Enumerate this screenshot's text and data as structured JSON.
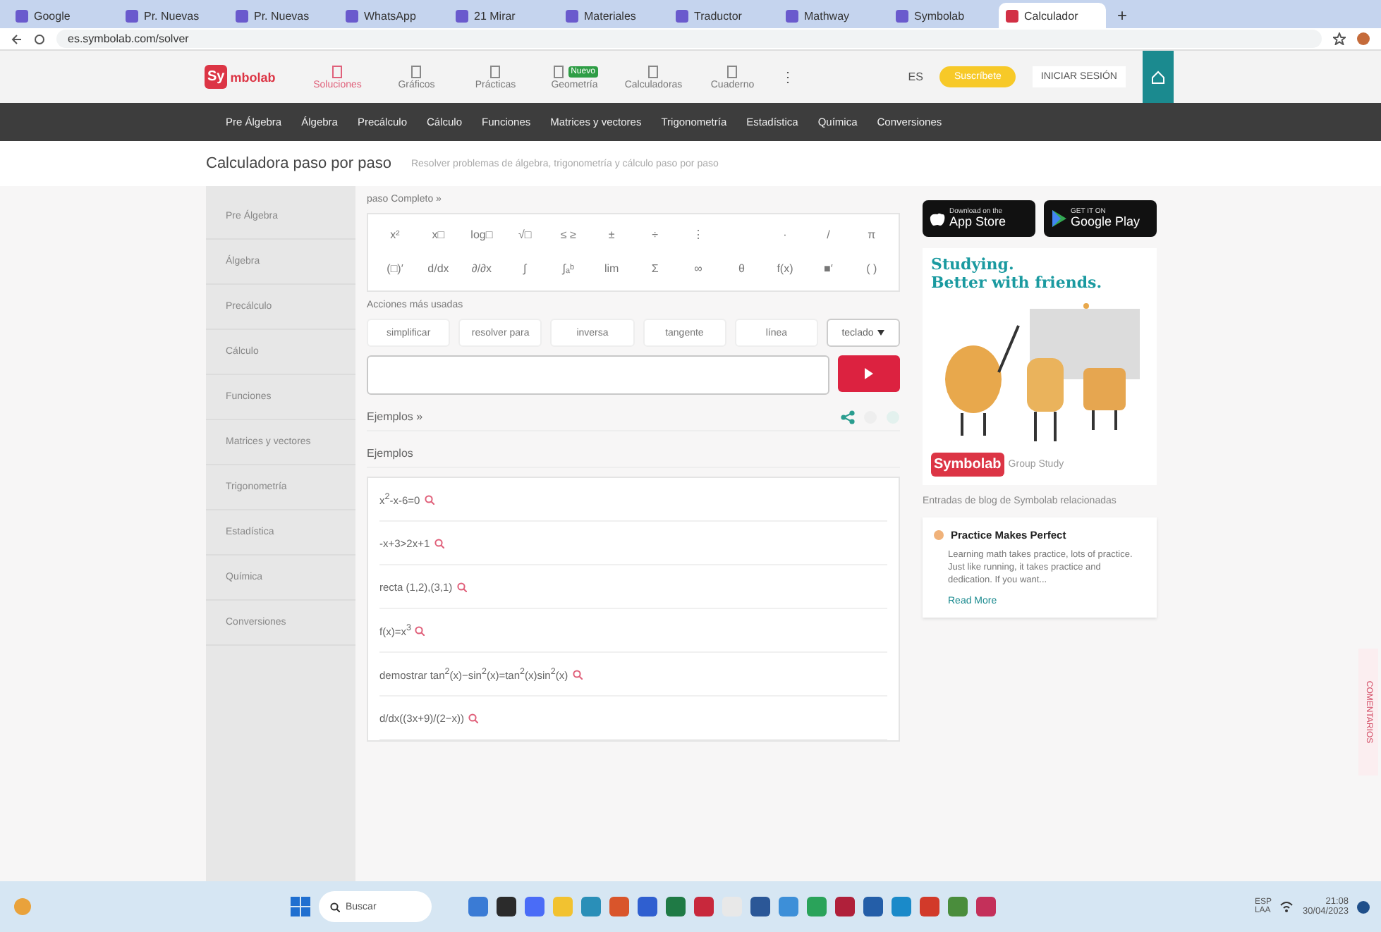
{
  "browser": {
    "tabs": [
      {
        "label": "Google",
        "selected": false
      },
      {
        "label": "Pr. Nuevas",
        "selected": false
      },
      {
        "label": "Pr. Nuevas",
        "selected": false
      },
      {
        "label": "WhatsApp",
        "selected": false
      },
      {
        "label": "21 Mirar",
        "selected": false
      },
      {
        "label": "Materiales",
        "selected": false
      },
      {
        "label": "Traductor",
        "selected": false
      },
      {
        "label": "Mathway",
        "selected": false
      },
      {
        "label": "Symbolab",
        "selected": false
      },
      {
        "label": "Calculador",
        "selected": true
      }
    ],
    "new_tab": "+",
    "url": "es.symbolab.com/solver"
  },
  "header": {
    "logo_mark": "Sy",
    "logo_text": "mbolab",
    "nav": [
      {
        "label": "Soluciones",
        "selected": true
      },
      {
        "label": "Gráficos",
        "selected": false
      },
      {
        "label": "Prácticas",
        "selected": false
      },
      {
        "label": "Geometría",
        "selected": false,
        "badge": "Nuevo"
      },
      {
        "label": "Calculadoras",
        "selected": false
      },
      {
        "label": "Cuaderno",
        "selected": false
      }
    ],
    "more": "⋮",
    "language": "ES",
    "subscribe": "Suscríbete",
    "login": "INICIAR SESIÓN"
  },
  "subjects": [
    "Pre Álgebra",
    "Álgebra",
    "Precálculo",
    "Cálculo",
    "Funciones",
    "Matrices y vectores",
    "Trigonometría",
    "Estadística",
    "Química",
    "Conversiones"
  ],
  "title": "Calculadora paso por paso",
  "subtitle": "Resolver problemas de álgebra, trigonometría y cálculo paso por paso",
  "sidebar": [
    {
      "label": "Pre Álgebra",
      "selected": false
    },
    {
      "label": "Álgebra",
      "selected": false
    },
    {
      "label": "Precálculo",
      "selected": false
    },
    {
      "label": "Cálculo",
      "selected": false
    },
    {
      "label": "Funciones",
      "selected": false
    },
    {
      "label": "Matrices y vectores",
      "selected": false
    },
    {
      "label": "Trigonometría",
      "selected": false
    },
    {
      "label": "Estadística",
      "selected": false
    },
    {
      "label": "Química",
      "selected": false
    },
    {
      "label": "Conversiones",
      "selected": false
    }
  ],
  "solver": {
    "mode_link": "paso Completo »",
    "keypad_rows": [
      [
        "x²",
        "x□",
        "log□",
        "√□",
        "≤ ≥",
        "±",
        "÷",
        "⋮",
        "",
        "·",
        "/",
        "π"
      ],
      [
        "(□)′",
        "d/dx",
        "∂/∂x",
        "∫",
        "∫ₐᵇ",
        "lim",
        "Σ",
        "∞",
        "θ",
        "f(x)",
        "■′",
        "( )"
      ]
    ],
    "actions_label": "Acciones más usadas",
    "actions": [
      "simplificar",
      "resolver para",
      "inversa",
      "tangente",
      "línea"
    ],
    "keyboard": "teclado",
    "examples_link": "Ejemplos »",
    "examples_title": "Ejemplos",
    "examples": [
      "x$^{2}$-x-6=0",
      "-x+3>2x+1",
      "recta (1,2),(3,1)",
      "f(x)=x$^{3}$",
      "demostrar tan$^{2}$(x)−sin$^{2}$(x)=tan$^{2}$(x)sin$^{2}$(x)",
      "d/dx((3x+9)/(2−x))"
    ]
  },
  "apps": [
    {
      "kind": "apple",
      "small": "Download on the",
      "big": "App Store"
    },
    {
      "kind": "google",
      "small": "GET IT ON",
      "big": "Google Play"
    }
  ],
  "promo": {
    "line1": "Studying.",
    "line2": "Better with friends.",
    "brand": "Symbolab",
    "tag": "Group Study"
  },
  "blog": {
    "heading": "Entradas de blog de Symbolab relacionadas",
    "posts": [
      {
        "title": "Practice Makes Perfect",
        "excerpt": "Learning math takes practice, lots of practice. Just like running, it takes practice and dedication. If you want...",
        "link": "Read More"
      }
    ]
  },
  "feedback": "COMENTARIOS",
  "taskbar": {
    "search": "Buscar",
    "apps": [
      {
        "color": "#3a7bd5"
      },
      {
        "color": "#2b2b2b"
      },
      {
        "color": "#4a6cf7"
      },
      {
        "color": "#f2c230"
      },
      {
        "color": "#2a8fb8"
      },
      {
        "color": "#d9552b"
      },
      {
        "color": "#2f5fd0"
      },
      {
        "color": "#1f7a45"
      },
      {
        "color": "#c8283c"
      },
      {
        "color": "#e8e8e8"
      },
      {
        "color": "#2b5797"
      },
      {
        "color": "#3d8fd8"
      },
      {
        "color": "#2aa35a"
      },
      {
        "color": "#b0203a"
      },
      {
        "color": "#245ea8"
      },
      {
        "color": "#1a8ac9"
      },
      {
        "color": "#d23a2a"
      },
      {
        "color": "#4a8d3c"
      },
      {
        "color": "#c4305a"
      }
    ],
    "lang1": "ESP",
    "lang2": "LAA",
    "time": "21:08",
    "date": "30/04/2023"
  }
}
